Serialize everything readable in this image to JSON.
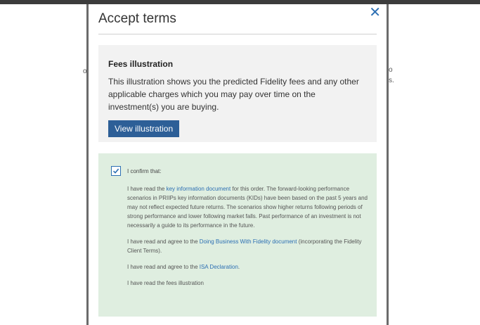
{
  "modal": {
    "title": "Accept terms",
    "close_symbol": "✕"
  },
  "fees": {
    "title": "Fees illustration",
    "text": "This illustration shows you the predicted Fidelity fees and any other applicable charges which you may pay over time on the investment(s) you are buying.",
    "button_label": "View illustration"
  },
  "confirm": {
    "checked": true,
    "label": "I confirm that:",
    "p1_before": "I have read the ",
    "p1_link": "key information document",
    "p1_after": " for this order. The forward-looking performance scenarios in PRIIPs key information documents (KIDs) have been based on the past 5 years and may not reflect expected future returns. The scenarios show higher returns following periods of strong performance and lower following market falls. Past performance of an investment is not necessarily a guide to its performance in the future.",
    "p2_before": "I have read and agree to the ",
    "p2_link": "Doing Business With Fidelity document",
    "p2_after": " (incorporating the Fidelity Client Terms).",
    "p3_before": "I have read and agree to the ",
    "p3_link": "ISA Declaration",
    "p3_after": ".",
    "p4": "I have read the fees illustration"
  },
  "background": {
    "left_fragment": "o",
    "right_fragment_1": "o",
    "right_fragment_2": "s."
  },
  "colors": {
    "accent": "#2c6fb3",
    "button": "#2d5f97",
    "confirm_bg": "#dfeee0",
    "fees_bg": "#f2f2f2"
  }
}
